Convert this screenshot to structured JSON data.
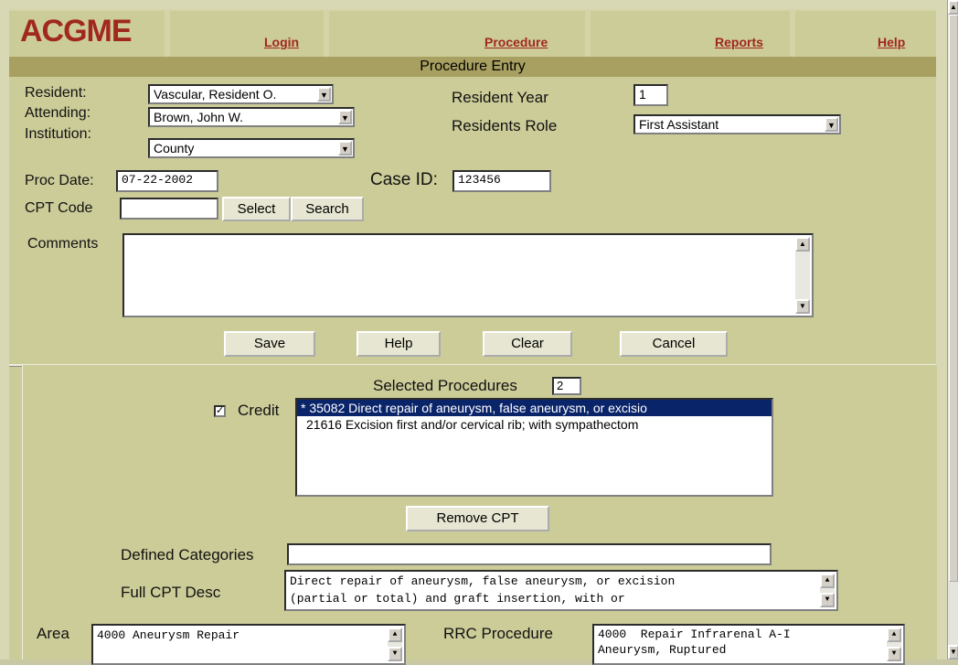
{
  "logo": "ACGME",
  "nav": {
    "login": "Login",
    "procedure": "Procedure",
    "reports": "Reports",
    "help": "Help"
  },
  "title": "Procedure Entry",
  "form": {
    "resident_label": "Resident:",
    "resident_value": "Vascular, Resident O.",
    "attending_label": "Attending:",
    "attending_value": "Brown, John W.",
    "institution_label": "Institution:",
    "institution_value": "County",
    "resident_year_label": "Resident Year",
    "resident_year_value": "1",
    "residents_role_label": "Residents Role",
    "residents_role_value": "First Assistant",
    "proc_date_label": "Proc Date:",
    "proc_date_value": "07-22-2002",
    "case_id_label": "Case ID:",
    "case_id_value": "123456",
    "cpt_code_label": "CPT Code",
    "cpt_code_value": "",
    "select_label": "Select",
    "search_label": "Search",
    "comments_label": "Comments",
    "comments_value": ""
  },
  "actions": {
    "save": "Save",
    "help": "Help",
    "clear": "Clear",
    "cancel": "Cancel"
  },
  "selected": {
    "title": "Selected Procedures",
    "count": "2",
    "credit_label": "Credit",
    "credit_checked": true,
    "items": [
      "* 35082 Direct repair of aneurysm, false aneurysm, or excisio",
      "21616 Excision first and/or cervical rib; with sympathectom"
    ],
    "remove_label": "Remove CPT"
  },
  "details": {
    "defined_categories_label": "Defined Categories",
    "defined_categories_value": "",
    "full_cpt_label": "Full CPT Desc",
    "full_cpt_line1": "Direct repair of aneurysm, false aneurysm, or excision",
    "full_cpt_line2": "(partial or total) and graft insertion, with or",
    "area_label": "Area",
    "area_value": "4000 Aneurysm Repair",
    "rrc_label": "RRC Procedure",
    "rrc_line1": "4000  Repair Infrarenal A-I",
    "rrc_line2": "Aneurysm, Ruptured"
  },
  "colors": {
    "brand": "#a0281e",
    "panel": "#cccc99",
    "titlebar": "#a8a060",
    "selection": "#0a246a"
  }
}
